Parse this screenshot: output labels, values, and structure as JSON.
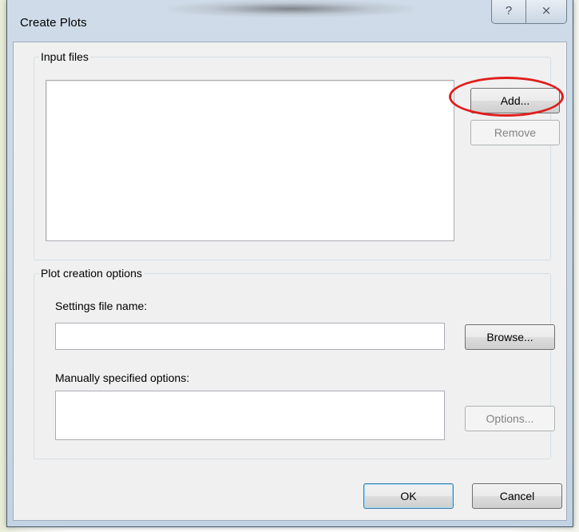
{
  "window": {
    "title": "Create Plots",
    "help_glyph": "?",
    "close_glyph": "⨯"
  },
  "input_files": {
    "group_label": "Input files",
    "add_label": "Add...",
    "remove_label": "Remove"
  },
  "plot_options": {
    "group_label": "Plot creation options",
    "settings_label": "Settings file name:",
    "settings_value": "",
    "browse_label": "Browse...",
    "manual_label": "Manually specified options:",
    "manual_value": "",
    "options_label": "Options..."
  },
  "footer": {
    "ok_label": "OK",
    "cancel_label": "Cancel"
  },
  "annotation": {
    "highlight_color": "#e01e1e",
    "highlight_target": "add-button"
  }
}
